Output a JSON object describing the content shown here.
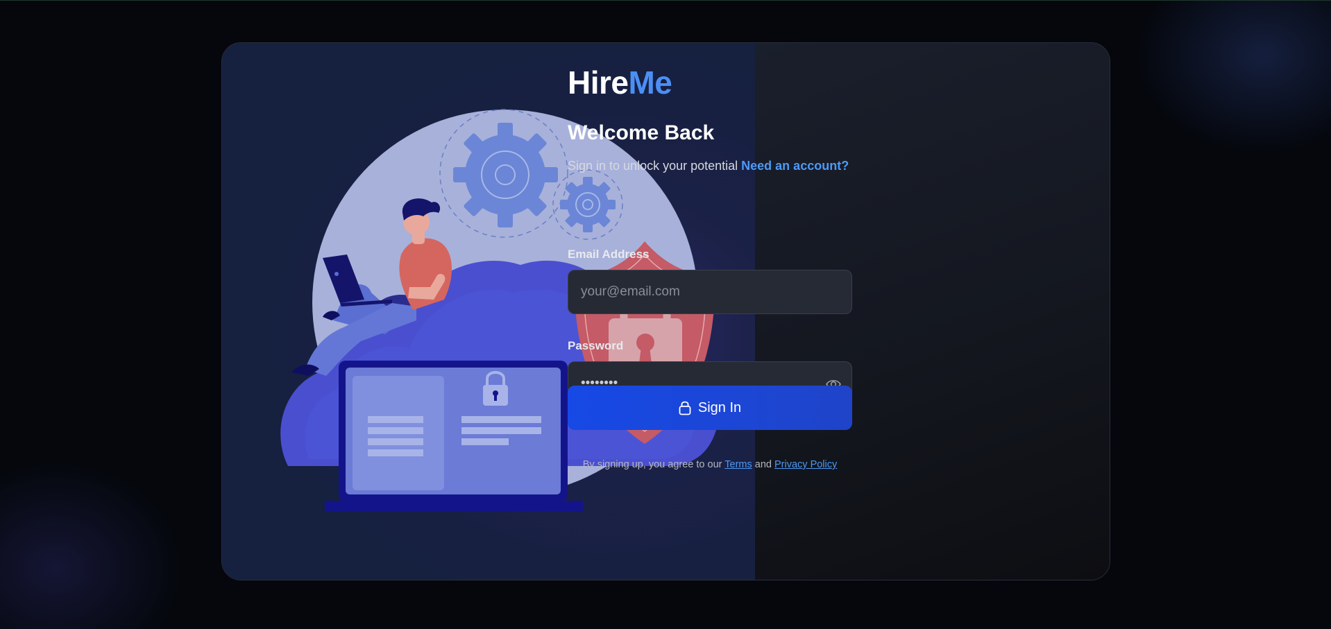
{
  "brand": {
    "part1": "Hire",
    "part2": "Me",
    "accent_color": "#4b8ff5"
  },
  "heading": "Welcome Back",
  "subtitle": {
    "text": "Sign in to unlock your potential",
    "link": "Need an account?"
  },
  "email": {
    "label": "Email Address",
    "placeholder": "your@email.com",
    "value": ""
  },
  "password": {
    "label": "Password",
    "value": "••••••••",
    "toggle_icon": "eye-icon"
  },
  "sign_in_button": {
    "label": "Sign In",
    "icon": "lock-icon",
    "color": "#1749e6"
  },
  "legal": {
    "prefix": "By signing up, you agree to our",
    "terms": "Terms",
    "and": "and",
    "privacy": "Privacy Policy"
  },
  "illustration": {
    "icons": [
      "gear-icon",
      "shield-lock-icon",
      "laptop-icon",
      "cloud-icon",
      "person-icon"
    ]
  }
}
